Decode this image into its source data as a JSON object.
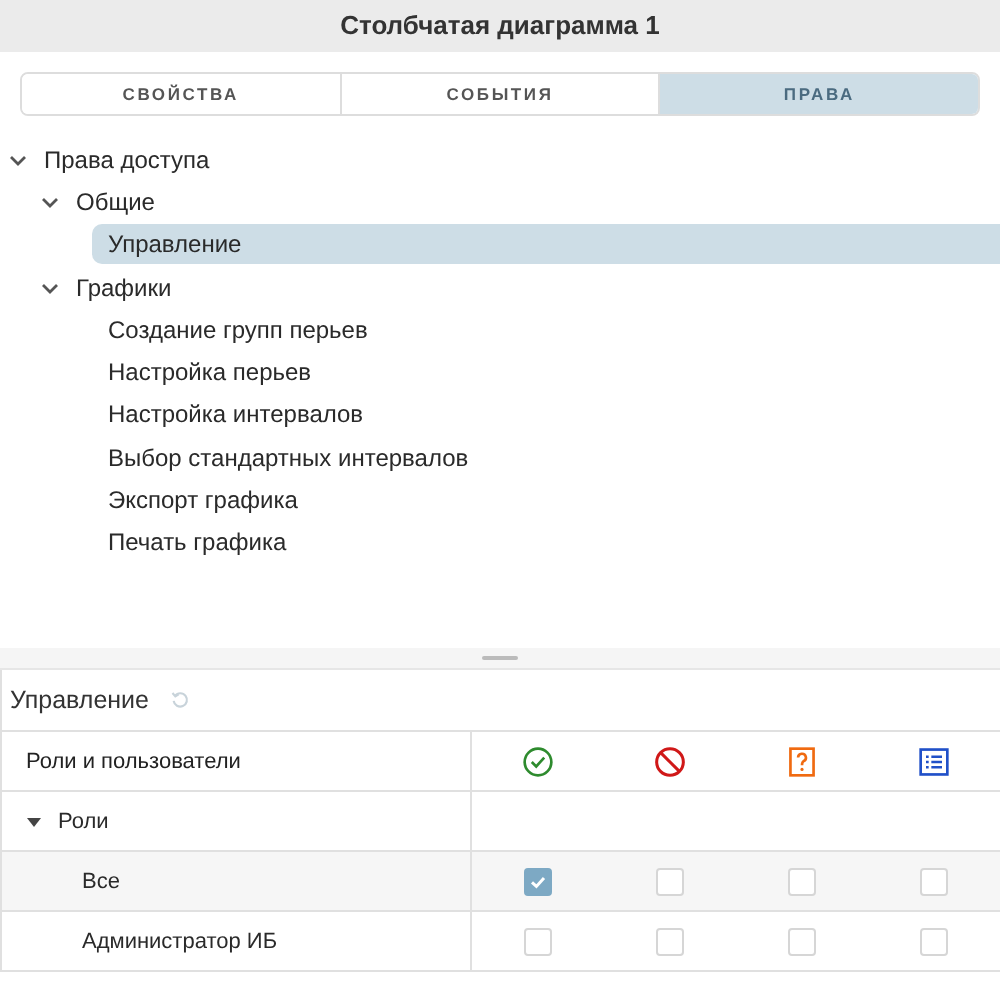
{
  "window": {
    "title": "Столбчатая диаграмма 1"
  },
  "tabs": [
    {
      "label": "СВОЙСТВА",
      "selected": false
    },
    {
      "label": "СОБЫТИЯ",
      "selected": false
    },
    {
      "label": "ПРАВА",
      "selected": true
    }
  ],
  "tree": [
    {
      "label": "Права доступа",
      "expanded": true,
      "selected": false,
      "children": [
        {
          "label": "Общие",
          "expanded": true,
          "selected": false,
          "children": [
            {
              "label": "Управление",
              "selected": true
            }
          ]
        },
        {
          "label": "Графики",
          "expanded": true,
          "selected": false,
          "children": [
            {
              "label": "Создание групп перьев",
              "selected": false
            },
            {
              "label": "Настройка перьев",
              "selected": false
            },
            {
              "label": "Настройка интервалов",
              "selected": false
            },
            {
              "label": "Выбор стандартных интервалов",
              "selected": false
            },
            {
              "label": "Экспорт графика",
              "selected": false
            },
            {
              "label": "Печать графика",
              "selected": false
            }
          ]
        }
      ]
    }
  ],
  "permissions": {
    "title": "Управление",
    "header": "Роли и пользователи",
    "columns": [
      {
        "kind": "allow"
      },
      {
        "kind": "deny"
      },
      {
        "kind": "ask"
      },
      {
        "kind": "list"
      }
    ],
    "groups": [
      {
        "label": "Роли",
        "expanded": true,
        "rows": [
          {
            "label": "Все",
            "selected": true,
            "checks": [
              true,
              false,
              false,
              false
            ]
          },
          {
            "label": "Администратор ИБ",
            "selected": false,
            "checks": [
              false,
              false,
              false,
              false
            ]
          }
        ]
      }
    ]
  }
}
